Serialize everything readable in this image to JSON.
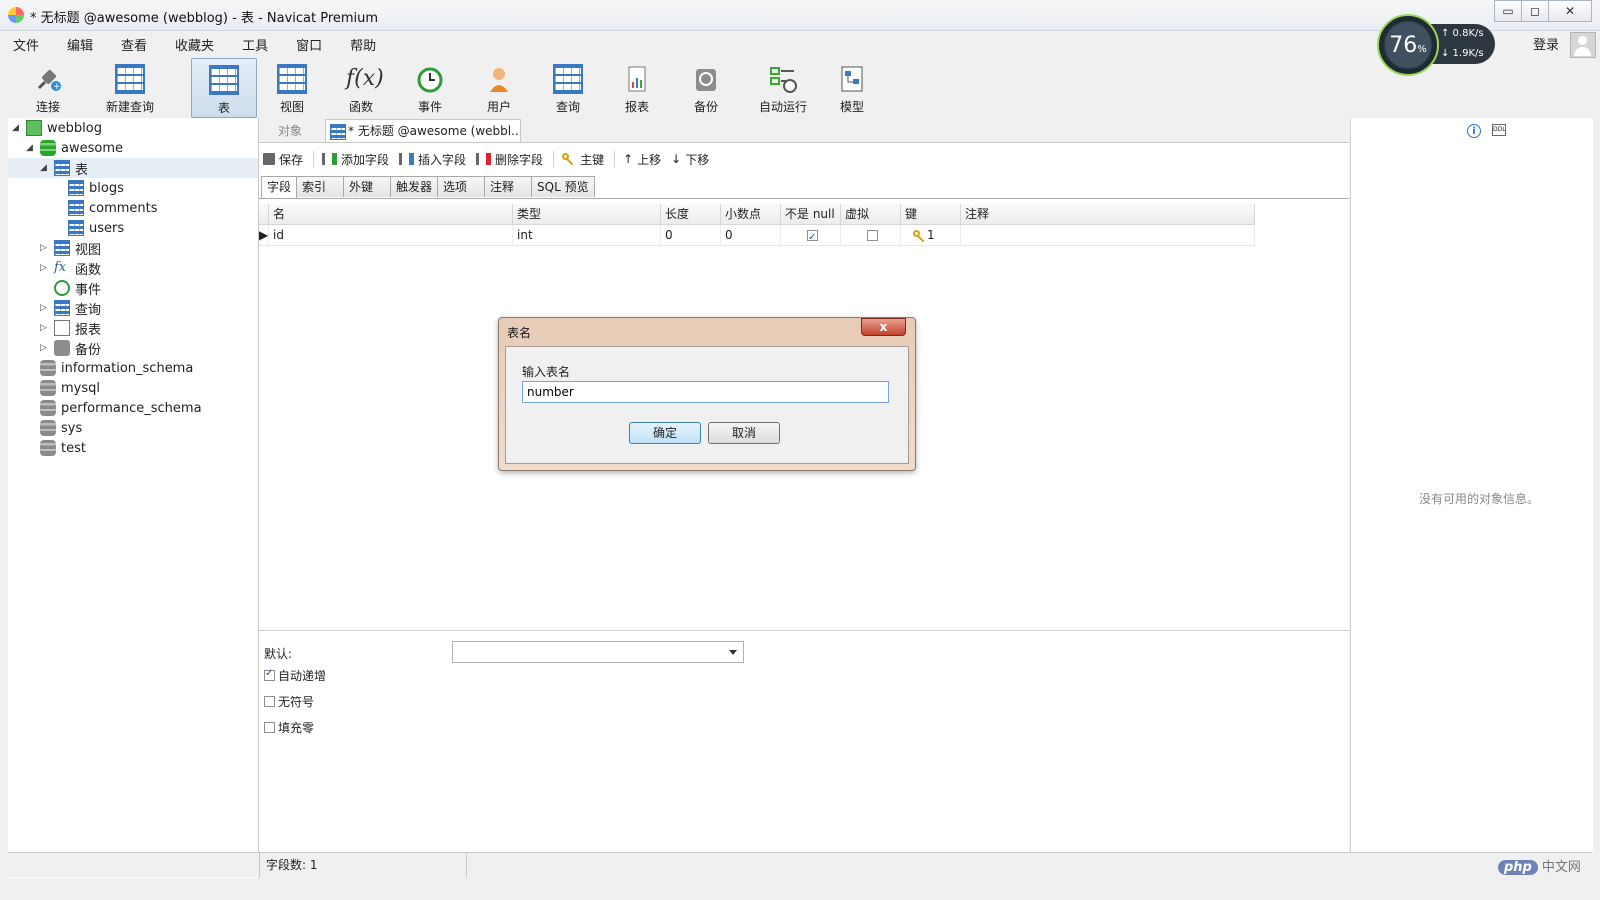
{
  "window": {
    "title": "* 无标题 @awesome (webblog) - 表 - Navicat Premium",
    "min": "▭",
    "max": "◻",
    "close": "✕"
  },
  "menu": [
    "文件",
    "编辑",
    "查看",
    "收藏夹",
    "工具",
    "窗口",
    "帮助"
  ],
  "account": {
    "login": "登录"
  },
  "speed": {
    "percent": "76",
    "percent_unit": "%",
    "up": "↑ 0.8K/s",
    "down": "↓ 1.9K/s"
  },
  "toolbar": [
    {
      "label": "连接",
      "icon": "plug-icon"
    },
    {
      "label": "新建查询",
      "icon": "new-query-icon"
    },
    {
      "label": "表",
      "icon": "table-icon"
    },
    {
      "label": "视图",
      "icon": "view-icon"
    },
    {
      "label": "函数",
      "icon": "function-icon"
    },
    {
      "label": "事件",
      "icon": "clock-icon"
    },
    {
      "label": "用户",
      "icon": "user-icon"
    },
    {
      "label": "查询",
      "icon": "query-icon"
    },
    {
      "label": "报表",
      "icon": "report-icon"
    },
    {
      "label": "备份",
      "icon": "backup-icon"
    },
    {
      "label": "自动运行",
      "icon": "schedule-icon"
    },
    {
      "label": "模型",
      "icon": "model-icon"
    }
  ],
  "tree": {
    "connection": "webblog",
    "database": "awesome",
    "tables_folder": "表",
    "tables": [
      "blogs",
      "comments",
      "users"
    ],
    "folders": [
      "视图",
      "函数",
      "事件",
      "查询",
      "报表",
      "备份"
    ],
    "other_databases": [
      "information_schema",
      "mysql",
      "performance_schema",
      "sys",
      "test"
    ]
  },
  "tabs": {
    "objects": "对象",
    "document": "* 无标题 @awesome (webbl..."
  },
  "subtoolbar": {
    "save": "保存",
    "add_field": "添加字段",
    "insert_field": "插入字段",
    "delete_field": "删除字段",
    "primary_key": "主键",
    "move_up": "上移",
    "move_down": "下移"
  },
  "field_tabs": [
    "字段",
    "索引",
    "外键",
    "触发器",
    "选项",
    "注释",
    "SQL 预览"
  ],
  "grid": {
    "columns": [
      "名",
      "类型",
      "长度",
      "小数点",
      "不是 null",
      "虚拟",
      "键",
      "注释"
    ],
    "rows": [
      {
        "name": "id",
        "type": "int",
        "length": "0",
        "decimals": "0",
        "not_null": true,
        "virtual": false,
        "key": "1",
        "comment": ""
      }
    ]
  },
  "field_props": {
    "default_label": "默认:",
    "default_value": "",
    "auto_increment": "自动递增",
    "auto_increment_checked": true,
    "unsigned": "无符号",
    "unsigned_checked": false,
    "zerofill": "填充零",
    "zerofill_checked": false
  },
  "right_pane": {
    "info_icon": "i",
    "ddl_icon": "DDL",
    "empty_text": "没有可用的对象信息。"
  },
  "status": {
    "field_count": "字段数: 1"
  },
  "watermark": {
    "badge": "php",
    "text": "中文网"
  },
  "dialog": {
    "title": "表名",
    "close": "x",
    "label": "输入表名",
    "input_value": "number",
    "ok": "确定",
    "cancel": "取消"
  }
}
